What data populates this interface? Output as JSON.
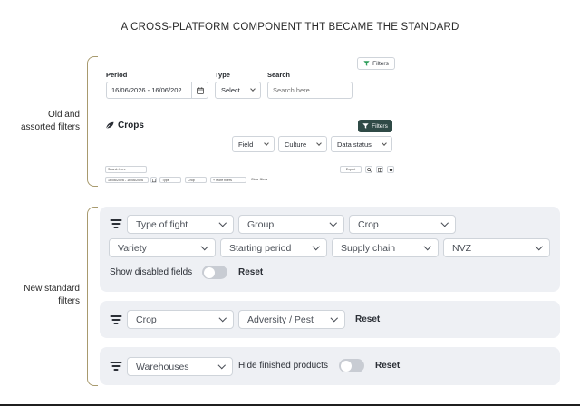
{
  "title": "A CROSS-PLATFORM COMPONENT THT BECAME THE STANDARD",
  "sections": {
    "old": [
      "Old and",
      "assorted filters"
    ],
    "new": [
      "New standard",
      "filters"
    ]
  },
  "old_filters": {
    "period_label": "Period",
    "period_value": "16/06/2026 - 16/06/202",
    "type_label": "Type",
    "type_value": "Select",
    "search_label": "Search",
    "search_placeholder": "Search here",
    "filters_button": "Filters",
    "crops_title": "Crops",
    "filters_button_dark": "Filters",
    "field_select": "Field",
    "culture_select": "Culture",
    "data_status_select": "Data status",
    "mini": {
      "search_placeholder": "Search here",
      "date_value": "16/06/2026 - 16/06/2026",
      "type": "Type",
      "crop": "Crop",
      "more_filters": "+ More filters",
      "clear_filters": "Clear filters",
      "export": "Export"
    }
  },
  "new_filters": {
    "panel1": {
      "row1": [
        "Type of fight",
        "Group",
        "Crop"
      ],
      "row2": [
        "Variety",
        "Starting period",
        "Supply chain",
        "NVZ"
      ],
      "toggle_label": "Show disabled fields",
      "toggle_on": false,
      "reset": "Reset"
    },
    "panel2": {
      "selects": [
        "Crop",
        "Adversity / Pest"
      ],
      "reset": "Reset"
    },
    "panel3": {
      "select": "Warehouses",
      "toggle_label": "Hide finished products",
      "toggle_on": false,
      "reset": "Reset"
    }
  },
  "colors": {
    "panel_bg": "#eef0f4",
    "dark_button": "#2f4a46",
    "bracket": "#a89a6e",
    "accent_green": "#2e9e5b"
  }
}
